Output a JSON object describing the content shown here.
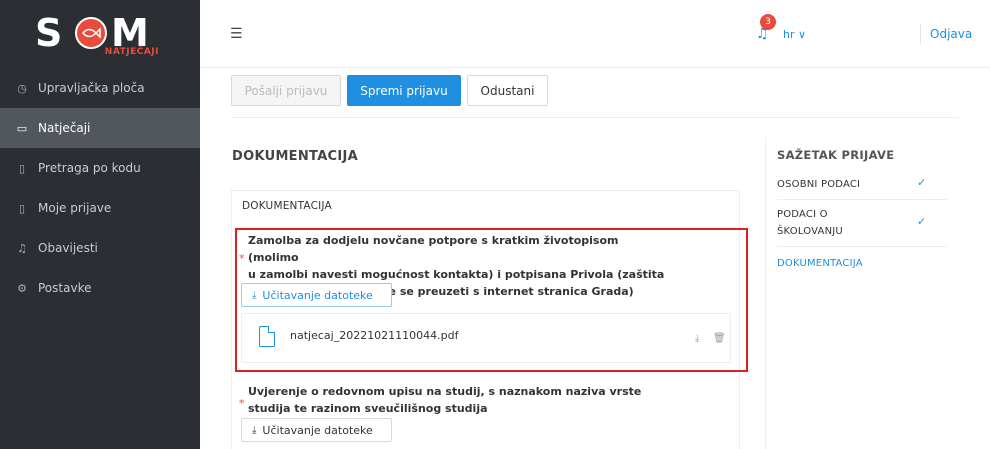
{
  "logo": {
    "brand": "S",
    "brand_rest": "M",
    "sub": "NATJEČAJI"
  },
  "sidebar": {
    "items": [
      {
        "label": "Upravljačka ploča",
        "icon": "◷"
      },
      {
        "label": "Natječaji",
        "icon": "▭"
      },
      {
        "label": "Pretraga po kodu",
        "icon": "▯"
      },
      {
        "label": "Moje prijave",
        "icon": "▯"
      },
      {
        "label": "Obavijesti",
        "icon": "♫"
      },
      {
        "label": "Postavke",
        "icon": "⚙"
      }
    ]
  },
  "header": {
    "menu_icon": "☰",
    "notifications_count": "3",
    "bell_icon": "♫",
    "language": "hr ∨",
    "logout": "Odjava"
  },
  "toolbar": {
    "submit_label": "Pošalji prijavu",
    "save_label": "Spremi prijavu",
    "cancel_label": "Odustani"
  },
  "main": {
    "section_title": "DOKUMENTACIJA",
    "card_title": "DOKUMENTACIJA",
    "doc1": {
      "line1": "Zamolba za dodjelu novčane potpore s kratkim životopisom (molimo",
      "line2": "u zamolbi navesti mogućnost kontakta) i potpisana Privola (zaštita",
      "line3": "osobnih podataka,može se preuzeti s internet stranica Grada)",
      "upload_label": "Učitavanje datoteke",
      "file_name": "natjecaj_20221021110044.pdf"
    },
    "doc2": {
      "line1": "Uvjerenje o redovnom upisu na studij, s naznakom naziva vrste",
      "line2": "studija te razinom sveučilišnog studija",
      "upload_label": "Učitavanje datoteke"
    },
    "required_mark": "*",
    "upload_icon": "⤓",
    "download_icon": "⤓",
    "delete_icon": "🗑"
  },
  "summary": {
    "title": "SAŽETAK PRIJAVE",
    "items": [
      {
        "line1": "OSOBNI PODACI",
        "line2": "",
        "check": "✓"
      },
      {
        "line1": "PODACI O",
        "line2": "ŠKOLOVANJU",
        "check": "✓"
      },
      {
        "line1": "DOKUMENTACIJA",
        "line2": "",
        "check": ""
      }
    ]
  }
}
